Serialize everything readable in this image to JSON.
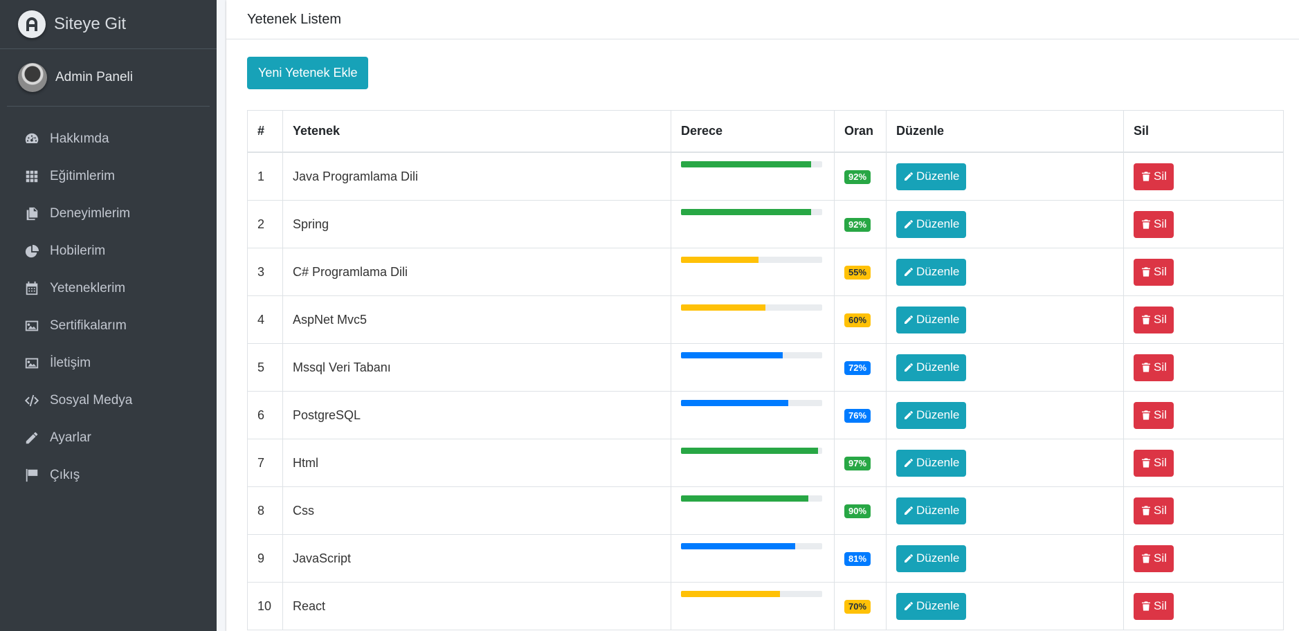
{
  "sidebar": {
    "brand": "Siteye Git",
    "user": "Admin Paneli",
    "items": [
      {
        "label": "Hakkımda",
        "icon": "dashboard-icon"
      },
      {
        "label": "Eğitimlerim",
        "icon": "grid-icon"
      },
      {
        "label": "Deneyimlerim",
        "icon": "copy-icon"
      },
      {
        "label": "Hobilerim",
        "icon": "pie-chart-icon"
      },
      {
        "label": "Yeteneklerim",
        "icon": "calendar-icon"
      },
      {
        "label": "Sertifikalarım",
        "icon": "image-icon"
      },
      {
        "label": "İletişim",
        "icon": "image-icon"
      },
      {
        "label": "Sosyal Medya",
        "icon": "code-icon"
      },
      {
        "label": "Ayarlar",
        "icon": "pencil-icon"
      },
      {
        "label": "Çıkış",
        "icon": "flag-icon"
      }
    ]
  },
  "card": {
    "title": "Yetenek Listem",
    "add_button": "Yeni Yetenek Ekle"
  },
  "table": {
    "headers": [
      "#",
      "Yetenek",
      "Derece",
      "Oran",
      "Düzenle",
      "Sil"
    ],
    "edit_label": "Düzenle",
    "delete_label": "Sil",
    "rows": [
      {
        "num": "1",
        "skill": "Java Programlama Dili",
        "percent": 92,
        "label": "92%",
        "status": "success"
      },
      {
        "num": "2",
        "skill": "Spring",
        "percent": 92,
        "label": "92%",
        "status": "success"
      },
      {
        "num": "3",
        "skill": "C# Programlama Dili",
        "percent": 55,
        "label": "55%",
        "status": "warning"
      },
      {
        "num": "4",
        "skill": "AspNet Mvc5",
        "percent": 60,
        "label": "60%",
        "status": "warning"
      },
      {
        "num": "5",
        "skill": "Mssql Veri Tabanı",
        "percent": 72,
        "label": "72%",
        "status": "primary"
      },
      {
        "num": "6",
        "skill": "PostgreSQL",
        "percent": 76,
        "label": "76%",
        "status": "primary"
      },
      {
        "num": "7",
        "skill": "Html",
        "percent": 97,
        "label": "97%",
        "status": "success"
      },
      {
        "num": "8",
        "skill": "Css",
        "percent": 90,
        "label": "90%",
        "status": "success"
      },
      {
        "num": "9",
        "skill": "JavaScript",
        "percent": 81,
        "label": "81%",
        "status": "primary"
      },
      {
        "num": "10",
        "skill": "React",
        "percent": 70,
        "label": "70%",
        "status": "warning"
      }
    ]
  },
  "colors": {
    "success": "#28a745",
    "warning": "#ffc107",
    "primary": "#007bff",
    "info": "#17a2b8",
    "danger": "#dc3545",
    "sidebar_bg": "#343a40"
  }
}
